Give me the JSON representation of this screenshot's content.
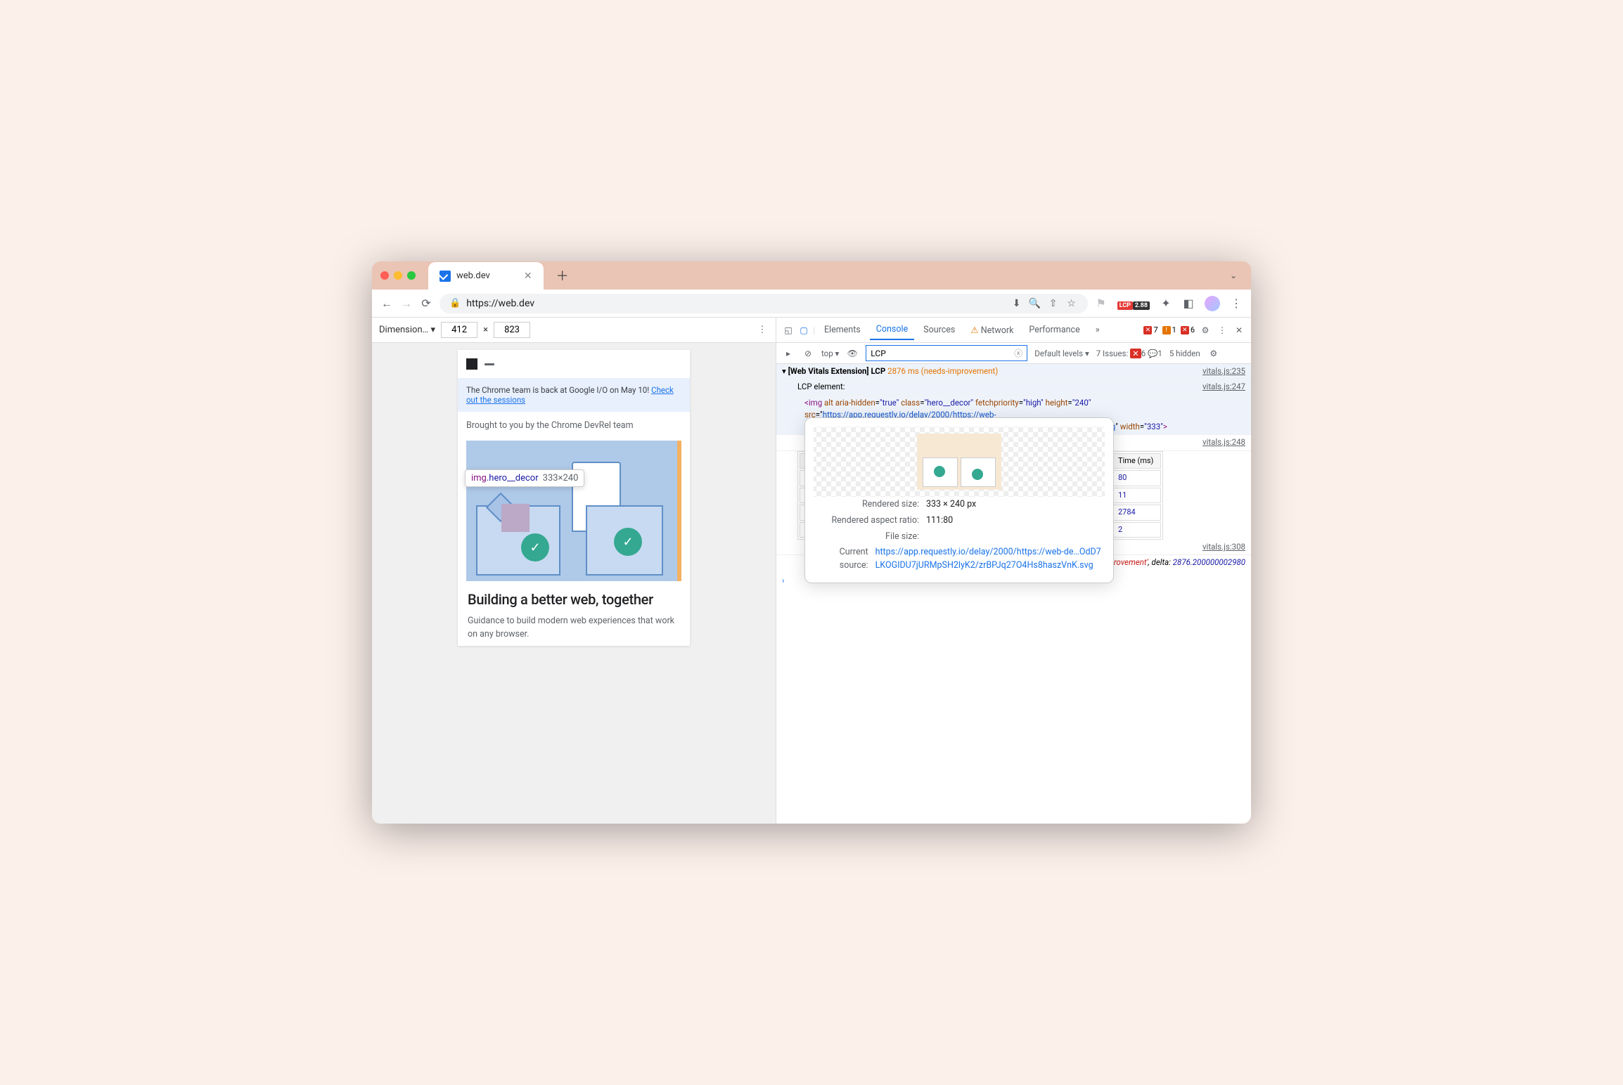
{
  "tab": {
    "title": "web.dev"
  },
  "url": "https://web.dev",
  "dimensions": {
    "label": "Dimension… ▾",
    "w": "412",
    "h": "823",
    "x": "×"
  },
  "ext": {
    "label": "LCP",
    "value": "2.88"
  },
  "page": {
    "banner_prefix": "The Chrome team is back at Google I/O on May 10! ",
    "banner_link": "Check out the sessions",
    "brought": "Brought to you by the Chrome DevRel team",
    "tooltip_sel": "img",
    "tooltip_class": ".hero__decor",
    "tooltip_size": "333×240",
    "h1": "Building a better web, together",
    "sub": "Guidance to build modern web experiences that work on any browser."
  },
  "dt": {
    "tabs": [
      "Elements",
      "Console",
      "Sources",
      "Network",
      "Performance"
    ],
    "warn_net": "⚠",
    "badges": {
      "err": "7",
      "warn": "1",
      "x": "6"
    },
    "filter": {
      "top": "top ▾",
      "value": "LCP",
      "levels": "Default levels ▾",
      "issues_label": "7 Issues:",
      "ix": "6",
      "ic": "1",
      "hidden": "5 hidden"
    }
  },
  "log": {
    "l1_pre": "[Web Vitals Extension] LCP ",
    "l1_ms": "2876 ms (needs-improvement)",
    "l1_src": "vitals.js:235",
    "l2": "LCP element:",
    "l2_src": "vitals.js:247",
    "img_src": "https://app.requestly.io/delay/2000/https://web-dev.imgix.net/image/jxu10dD7LKOGIDU7jURMpSH2lyK2/zrBPJq27O4Hs8haszVnK.svg",
    "l4_src": "vitals.js:248",
    "table_head": "Time (ms)",
    "table_rows": [
      "80",
      "11",
      "2784",
      "2"
    ],
    "l5_src": "vitals.js:308",
    "l5_a": "provement'",
    "l5_b": ", delta: ",
    "l5_c": "2876.200000002980"
  },
  "popup": {
    "rsize_k": "Rendered size:",
    "rsize_v": "333 × 240 px",
    "ratio_k": "Rendered aspect ratio:",
    "ratio_v": "111:80",
    "fsize_k": "File size:",
    "fsize_v": "",
    "src_k": "Current source:",
    "src_v": "https://app.requestly.io/delay/2000/https://web-de…OdD7LKOGIDU7jURMpSH2lyK2/zrBPJq27O4Hs8haszVnK.svg"
  }
}
